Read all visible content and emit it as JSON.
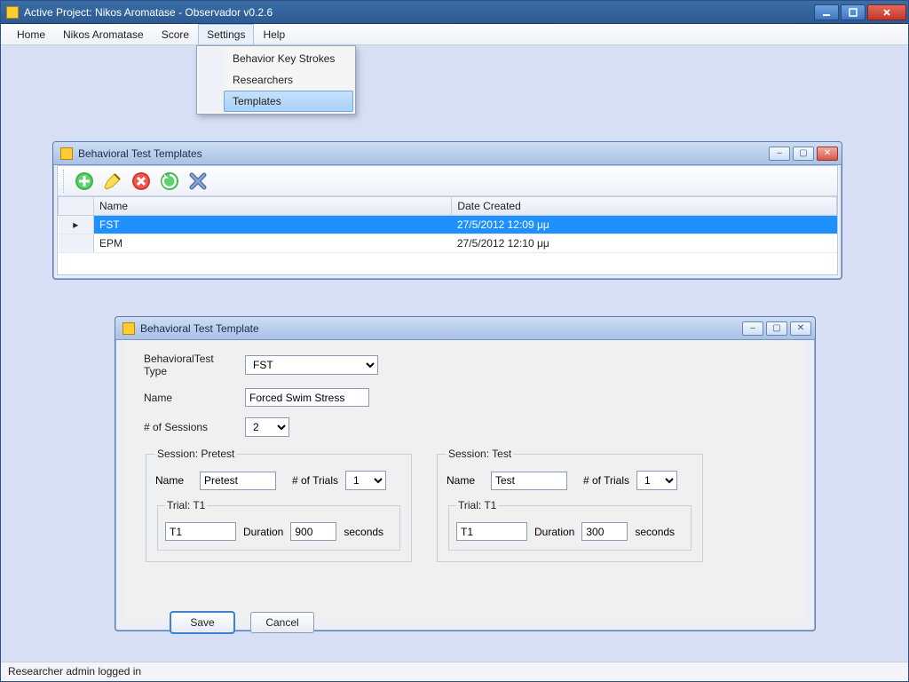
{
  "window": {
    "title": "Active Project: Nikos Aromatase - Observador v0.2.6"
  },
  "menubar": {
    "home": "Home",
    "project": "Nikos Aromatase",
    "score": "Score",
    "settings": "Settings",
    "help": "Help"
  },
  "settings_menu": {
    "bks": "Behavior Key Strokes",
    "researchers": "Researchers",
    "templates": "Templates"
  },
  "templates_window": {
    "title": "Behavioral Test Templates",
    "columns": {
      "name": "Name",
      "date": "Date Created"
    },
    "rows": [
      {
        "name": "FST",
        "date": "27/5/2012 12:09 μμ"
      },
      {
        "name": "EPM",
        "date": "27/5/2012 12:10 μμ"
      }
    ]
  },
  "edit_window": {
    "title": "Behavioral Test Template",
    "labels": {
      "type": "BehavioralTest Type",
      "name": "Name",
      "sessions": "# of Sessions",
      "sess_name": "Name",
      "trials": "# of Trials",
      "duration": "Duration",
      "seconds": "seconds"
    },
    "type_value": "FST",
    "name_value": "Forced Swim Stress",
    "sessions_value": "2",
    "session1": {
      "legend": "Session: Pretest",
      "name": "Pretest",
      "trials": "1",
      "trial_legend": "Trial: T1",
      "trial_name": "T1",
      "duration": "900"
    },
    "session2": {
      "legend": "Session: Test",
      "name": "Test",
      "trials": "1",
      "trial_legend": "Trial: T1",
      "trial_name": "T1",
      "duration": "300"
    },
    "buttons": {
      "save": "Save",
      "cancel": "Cancel"
    }
  },
  "status": "Researcher admin logged in"
}
